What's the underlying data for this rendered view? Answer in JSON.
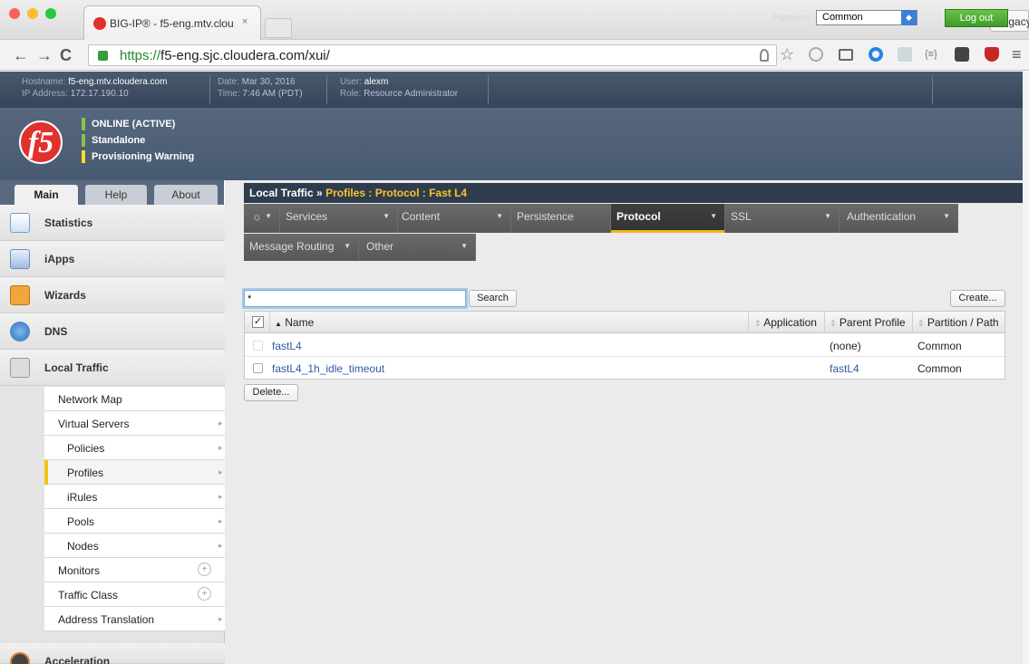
{
  "browser": {
    "tab_title": "BIG-IP® - f5-eng.mtv.clou",
    "tab_close": "×",
    "legacy_label": "Legacy",
    "url_https": "https://",
    "url_rest": "f5-eng.sjc.cloudera.com/xui/",
    "back": "←",
    "forward": "→",
    "reload": "C",
    "menu": "≡"
  },
  "info": {
    "hostname_key": "Hostname:",
    "hostname_val": "f5-eng.mtv.cloudera.com",
    "ip_key": "IP Address:",
    "ip_val": "172.17.190.10",
    "date_key": "Date:",
    "date_val": "Mar 30, 2016",
    "time_key": "Time:",
    "time_val": "7:46 AM (PDT)",
    "user_key": "User:",
    "user_val": "alexm",
    "role_key": "Role:",
    "role_val": "Resource Administrator",
    "partition_label": "Partition:",
    "partition_value": "Common",
    "logout": "Log out"
  },
  "status": {
    "online": "ONLINE (ACTIVE)",
    "standalone": "Standalone",
    "warning": "Provisioning Warning",
    "logo": "f5"
  },
  "left_tabs": [
    "Main",
    "Help",
    "About"
  ],
  "sidebar": {
    "sections": [
      "Statistics",
      "iApps",
      "Wizards",
      "DNS",
      "Local Traffic"
    ],
    "sub": [
      "Network Map",
      "Virtual Servers",
      "Policies",
      "Profiles",
      "iRules",
      "Pools",
      "Nodes",
      "Monitors",
      "Traffic Class",
      "Address Translation"
    ],
    "bottom": "Acceleration"
  },
  "breadcrumb": {
    "root": "Local Traffic",
    "sep": "»",
    "path": "Profiles : Protocol : Fast L4"
  },
  "menu": {
    "gear": "☼",
    "items": [
      "Services",
      "Content",
      "Persistence",
      "Protocol",
      "SSL",
      "Authentication"
    ],
    "items2": [
      "Message Routing",
      "Other"
    ]
  },
  "search": {
    "value": "*",
    "button": "Search",
    "create": "Create...",
    "delete": "Delete..."
  },
  "table": {
    "headers": [
      "Name",
      "Application",
      "Parent Profile",
      "Partition / Path"
    ],
    "rows": [
      {
        "name": "fastL4",
        "parent": "(none)",
        "partition": "Common"
      },
      {
        "name": "fastL4_1h_idle_timeout",
        "parent": "fastL4",
        "partition": "Common"
      }
    ]
  },
  "colors": {
    "accent_yellow": "#f7c528",
    "link_blue": "#2d5aa8",
    "green_status": "#8bc34a",
    "warning_yellow": "#f4e11c"
  }
}
